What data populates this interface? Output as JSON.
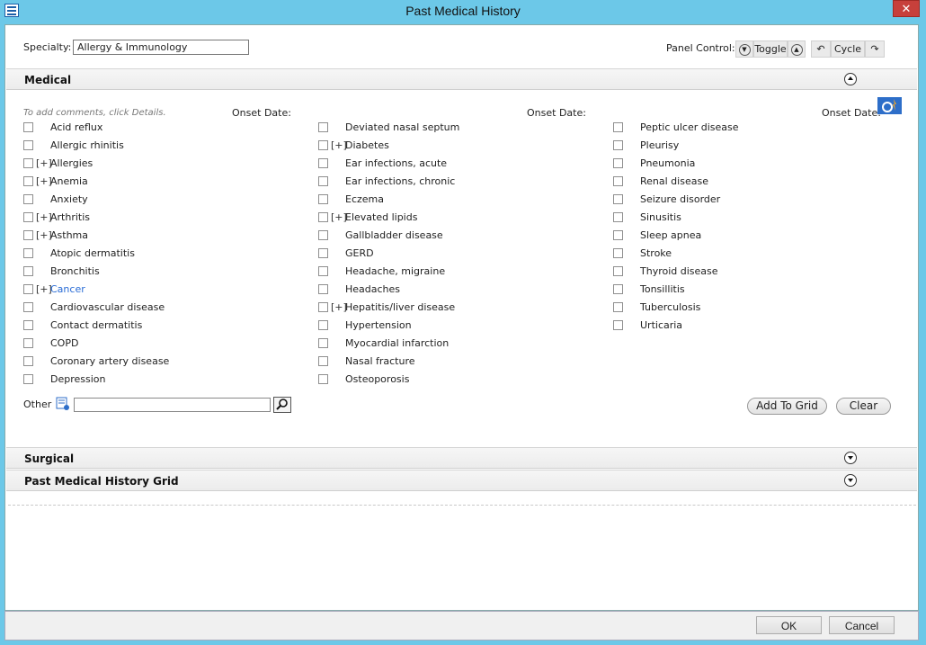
{
  "window": {
    "title": "Past Medical History",
    "close_glyph": "✕"
  },
  "header": {
    "specialty_label": "Specialty:",
    "specialty_value": "Allergy & Immunology",
    "panel_control_label": "Panel Control:",
    "toggle_label": "Toggle",
    "cycle_label": "Cycle"
  },
  "sections": {
    "medical": "Medical",
    "surgical": "Surgical",
    "grid": "Past Medical History Grid"
  },
  "medical": {
    "hint": "To add comments, click Details.",
    "onset_label": "Onset Date:",
    "columns": [
      [
        {
          "label": "Acid reflux",
          "expandable": false
        },
        {
          "label": "Allergic rhinitis",
          "expandable": false
        },
        {
          "label": "Allergies",
          "expandable": true
        },
        {
          "label": "Anemia",
          "expandable": true
        },
        {
          "label": "Anxiety",
          "expandable": false
        },
        {
          "label": "Arthritis",
          "expandable": true
        },
        {
          "label": "Asthma",
          "expandable": true
        },
        {
          "label": "Atopic dermatitis",
          "expandable": false
        },
        {
          "label": "Bronchitis",
          "expandable": false
        },
        {
          "label": "Cancer",
          "expandable": true,
          "link": true
        },
        {
          "label": "Cardiovascular disease",
          "expandable": false
        },
        {
          "label": "Contact dermatitis",
          "expandable": false
        },
        {
          "label": "COPD",
          "expandable": false
        },
        {
          "label": "Coronary artery disease",
          "expandable": false
        },
        {
          "label": "Depression",
          "expandable": false
        }
      ],
      [
        {
          "label": "Deviated nasal septum",
          "expandable": false
        },
        {
          "label": "Diabetes",
          "expandable": true
        },
        {
          "label": "Ear infections, acute",
          "expandable": false
        },
        {
          "label": "Ear infections, chronic",
          "expandable": false
        },
        {
          "label": "Eczema",
          "expandable": false
        },
        {
          "label": "Elevated lipids",
          "expandable": true
        },
        {
          "label": "Gallbladder disease",
          "expandable": false
        },
        {
          "label": "GERD",
          "expandable": false
        },
        {
          "label": "Headache, migraine",
          "expandable": false
        },
        {
          "label": "Headaches",
          "expandable": false
        },
        {
          "label": "Hepatitis/liver disease",
          "expandable": true
        },
        {
          "label": "Hypertension",
          "expandable": false
        },
        {
          "label": "Myocardial infarction",
          "expandable": false
        },
        {
          "label": "Nasal fracture",
          "expandable": false
        },
        {
          "label": "Osteoporosis",
          "expandable": false
        }
      ],
      [
        {
          "label": "Peptic ulcer disease",
          "expandable": false
        },
        {
          "label": "Pleurisy",
          "expandable": false
        },
        {
          "label": "Pneumonia",
          "expandable": false
        },
        {
          "label": "Renal disease",
          "expandable": false
        },
        {
          "label": "Seizure disorder",
          "expandable": false
        },
        {
          "label": "Sinusitis",
          "expandable": false
        },
        {
          "label": "Sleep apnea",
          "expandable": false
        },
        {
          "label": "Stroke",
          "expandable": false
        },
        {
          "label": "Thyroid disease",
          "expandable": false
        },
        {
          "label": "Tonsillitis",
          "expandable": false
        },
        {
          "label": "Tuberculosis",
          "expandable": false
        },
        {
          "label": "Urticaria",
          "expandable": false
        }
      ]
    ],
    "other_label": "Other",
    "other_value": "",
    "add_to_grid_label": "Add To Grid",
    "clear_label": "Clear"
  },
  "footer": {
    "ok_label": "OK",
    "cancel_label": "Cancel"
  },
  "icons": {
    "plus_marker": "[+]"
  },
  "colors": {
    "titlebar": "#6cc8e8",
    "link": "#2a6cd6",
    "close": "#c7403b"
  }
}
